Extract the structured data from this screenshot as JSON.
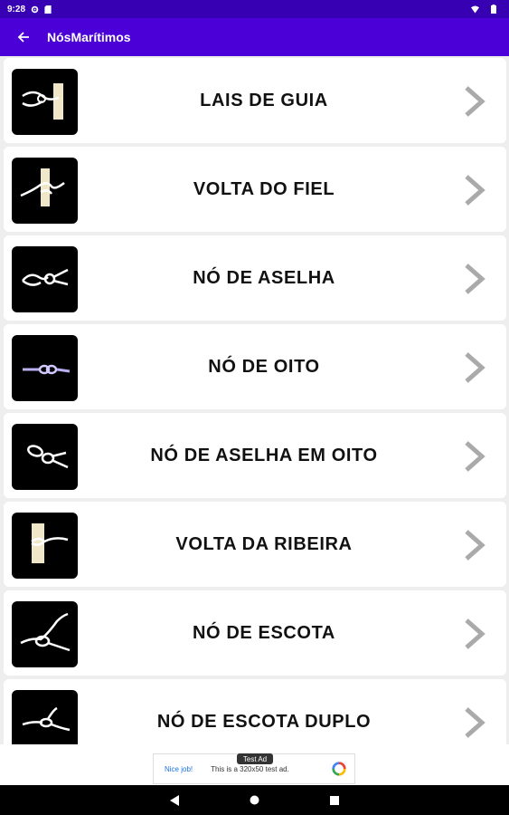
{
  "status_bar": {
    "time": "9:28"
  },
  "app_bar": {
    "title": "NósMarítimos"
  },
  "knots": [
    {
      "label": "LAIS DE GUIA",
      "icon": "bowline-icon"
    },
    {
      "label": "VOLTA DO FIEL",
      "icon": "clove-hitch-icon"
    },
    {
      "label": "NÓ DE ASELHA",
      "icon": "overhand-loop-icon"
    },
    {
      "label": "NÓ DE OITO",
      "icon": "figure-eight-icon"
    },
    {
      "label": "NÓ DE ASELHA EM OITO",
      "icon": "figure-eight-loop-icon"
    },
    {
      "label": "VOLTA DA RIBEIRA",
      "icon": "round-turn-icon"
    },
    {
      "label": "NÓ DE ESCOTA",
      "icon": "sheet-bend-icon"
    },
    {
      "label": "NÓ DE ESCOTA DUPLO",
      "icon": "double-sheet-bend-icon"
    }
  ],
  "ad": {
    "tag": "Test Ad",
    "cta": "Nice job!",
    "text": "This is a 320x50 test ad."
  },
  "colors": {
    "status_bar": "#3700b3",
    "app_bar": "#4a00d7",
    "chevron": "#aaaaaa"
  }
}
